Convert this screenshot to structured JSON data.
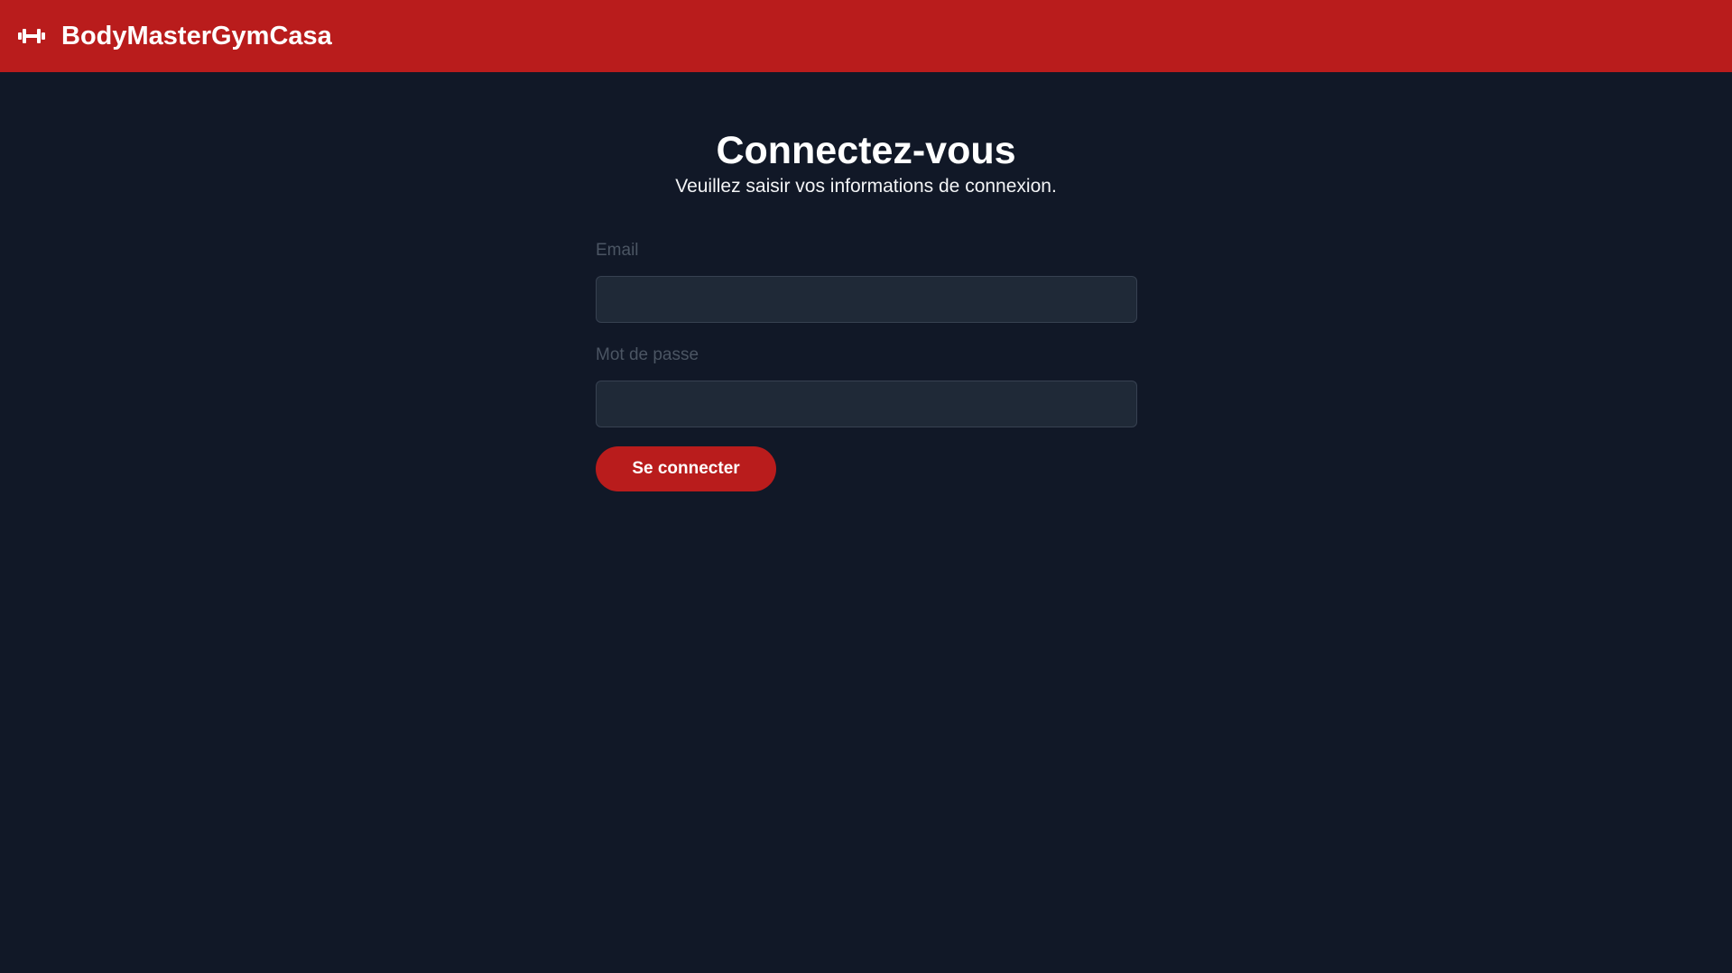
{
  "header": {
    "brand": "BodyMasterGymCasa",
    "logo_icon": "dumbbell-icon",
    "background_color": "#b91c1c"
  },
  "login": {
    "title": "Connectez-vous",
    "subtitle": "Veuillez saisir vos informations de connexion.",
    "email_label": "Email",
    "email_value": "",
    "password_label": "Mot de passe",
    "password_value": "",
    "submit_label": "Se connecter"
  },
  "colors": {
    "page_background": "#111827",
    "accent": "#b91c1c",
    "input_background": "#1f2937"
  }
}
